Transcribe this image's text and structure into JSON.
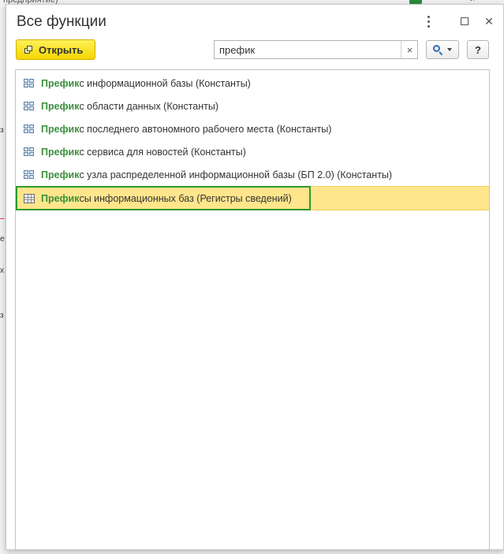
{
  "background": {
    "window_title_fragment": "предприятие)",
    "left_marks": [
      "з",
      "–",
      "е",
      "х",
      "з"
    ],
    "top_icons": [
      "chevron-icon",
      "bell-icon"
    ]
  },
  "dialog": {
    "title": "Все функции",
    "more_icon": "more-vertical-icon",
    "maximize_icon": "maximize-icon",
    "close_symbol": "✕"
  },
  "toolbar": {
    "open_label": "Открыть",
    "search_value": "префик",
    "search_placeholder": "",
    "clear_symbol": "×",
    "help_label": "?"
  },
  "results": [
    {
      "highlight": "Префик",
      "rest": "с информационной базы (Константы)",
      "icon": "constant-icon",
      "selected": false
    },
    {
      "highlight": "Префик",
      "rest": "с области данных (Константы)",
      "icon": "constant-icon",
      "selected": false
    },
    {
      "highlight": "Префик",
      "rest": "с последнего автономного рабочего места (Константы)",
      "icon": "constant-icon",
      "selected": false
    },
    {
      "highlight": "Префик",
      "rest": "с сервиса для новостей (Константы)",
      "icon": "constant-icon",
      "selected": false
    },
    {
      "highlight": "Префик",
      "rest": "с узла распределенной информационной базы (БП 2.0) (Константы)",
      "icon": "constant-icon",
      "selected": false
    },
    {
      "highlight": "Префик",
      "rest": "сы информационных баз (Регистры сведений)",
      "icon": "register-icon",
      "selected": true
    }
  ],
  "colors": {
    "accent_green": "#3c8f3c",
    "selection_yellow": "#ffe68c",
    "open_button_yellow": "#f5d500",
    "selection_frame": "#2e9a2e"
  }
}
